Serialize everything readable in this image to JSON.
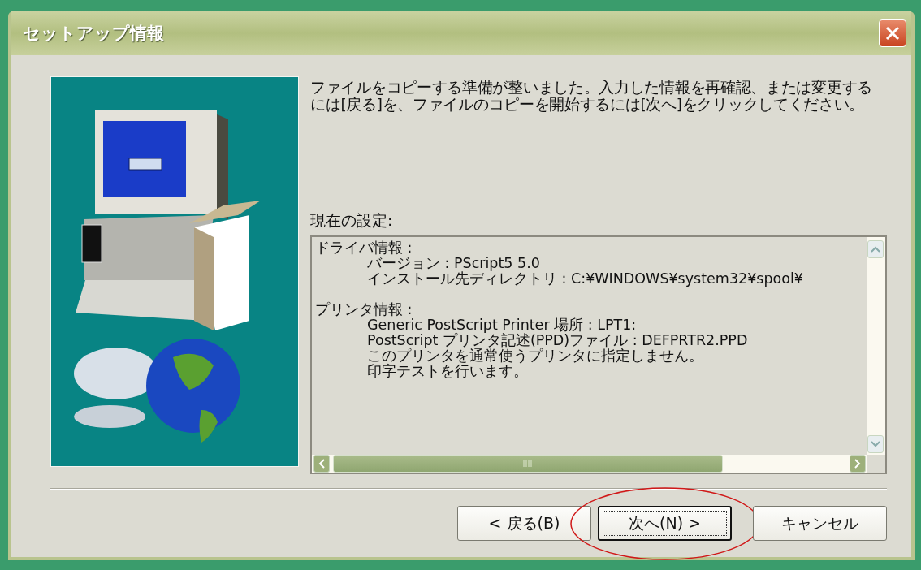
{
  "window": {
    "title": "セットアップ情報"
  },
  "message": "ファイルをコピーする準備が整いました。入力した情報を再確認、または変更するには[戻る]を、ファイルのコピーを開始するには[次へ]をクリックしてください。",
  "settings_label": "現在の設定:",
  "settings": [
    {
      "title": "ドライバ情報 :",
      "children": [
        {
          "text": "バージョン : PScript5 5.0"
        },
        {
          "text": "インストール先ディレクトリ : C:¥WINDOWS¥system32¥spool¥"
        }
      ]
    },
    {
      "title": "プリンタ情報 :",
      "children": [
        {
          "text": "Generic PostScript Printer 場所 : LPT1:"
        },
        {
          "text": "PostScript プリンタ記述(PPD)ファイル : DEFPRTR2.PPD"
        },
        {
          "text": "このプリンタを通常使うプリンタに指定しません。"
        },
        {
          "text": "印字テストを行います。"
        }
      ]
    }
  ],
  "buttons": [
    {
      "label": "< 戻る(B)",
      "default": false,
      "circled": false
    },
    {
      "label": "次へ(N) >",
      "default": true,
      "circled": true
    },
    {
      "label": "キャンセル",
      "default": false,
      "circled": false
    }
  ]
}
